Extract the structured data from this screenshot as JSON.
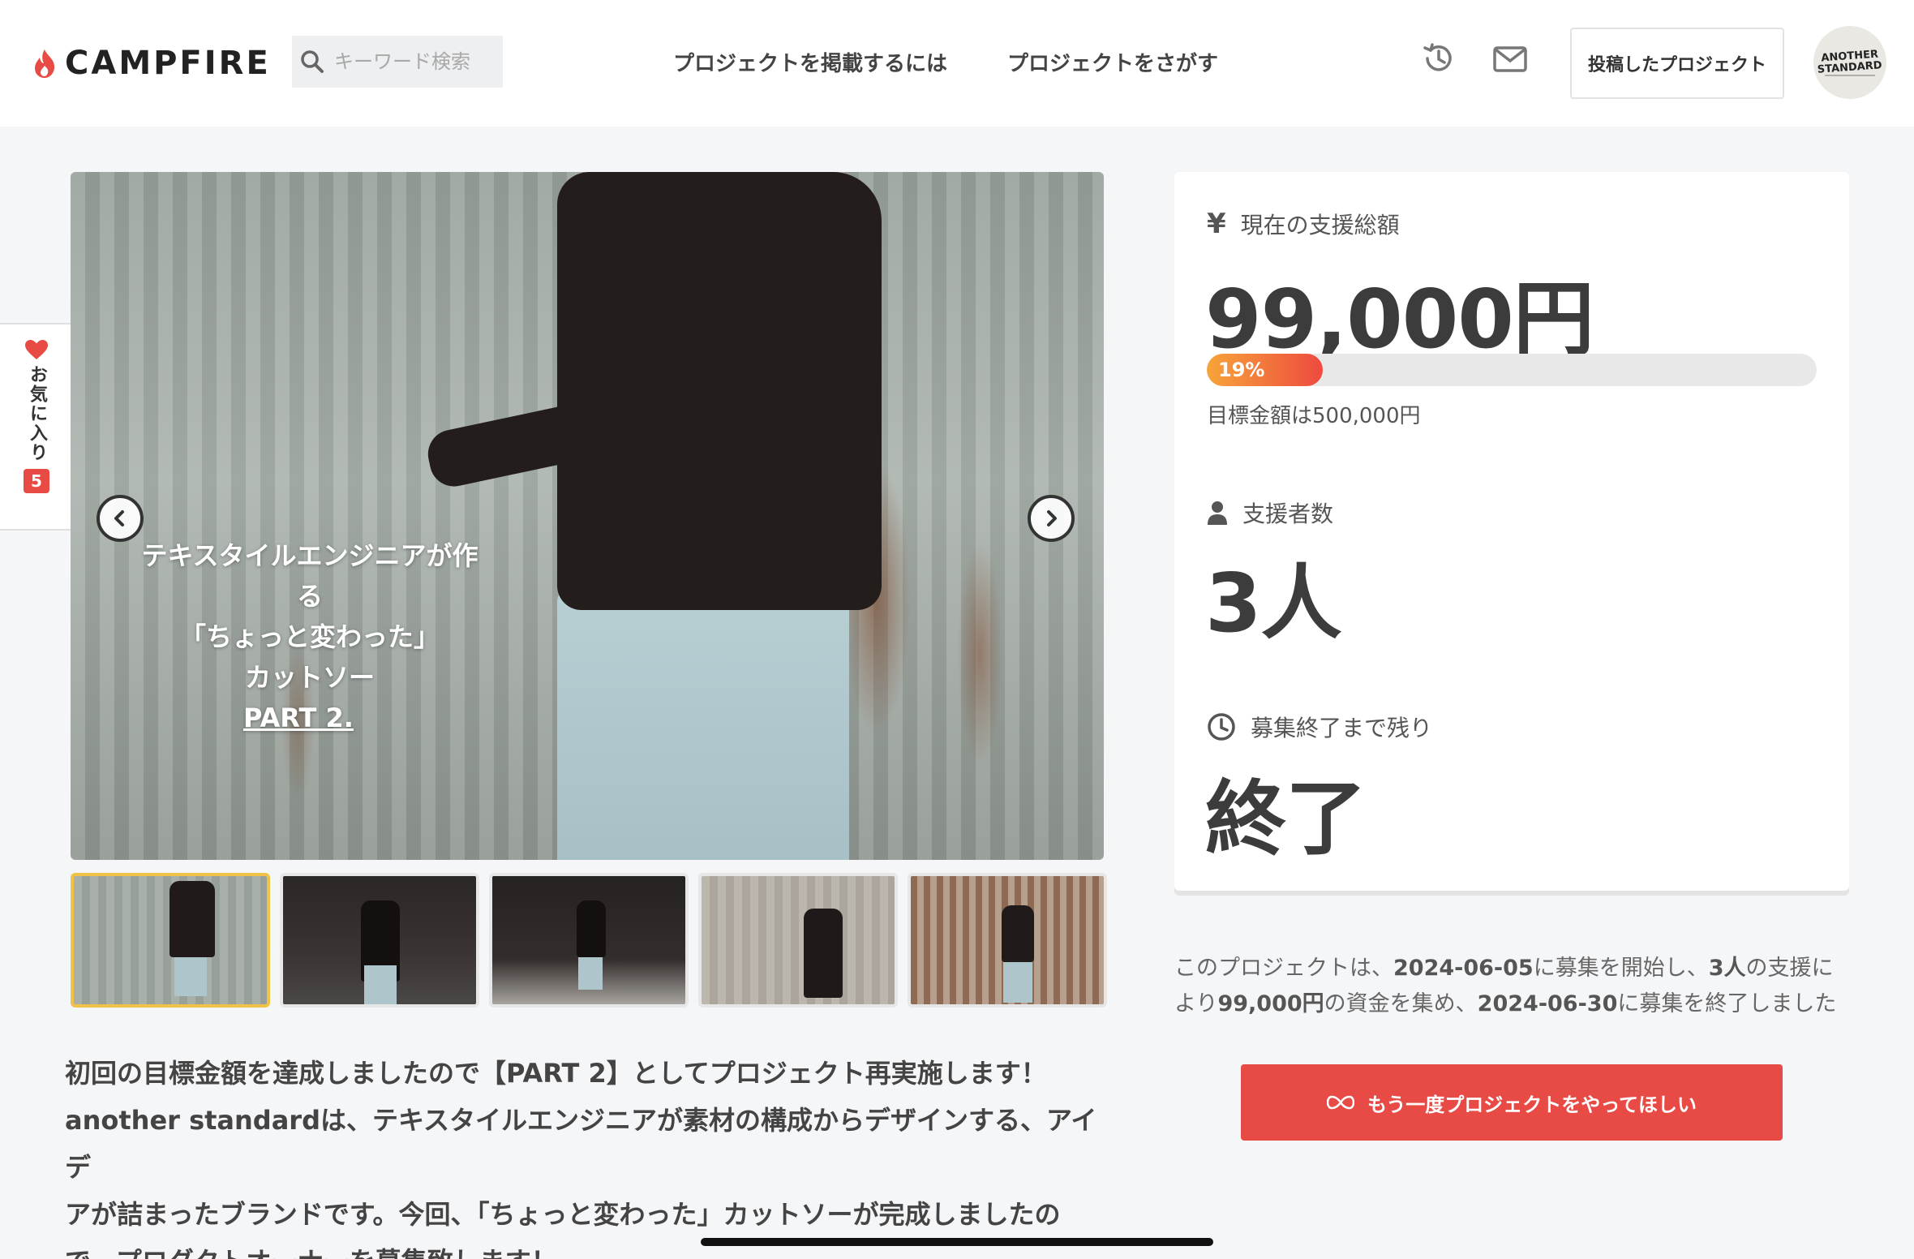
{
  "header": {
    "logo_text": "CAMPFIRE",
    "search_placeholder": "キーワード検索",
    "nav_post": "プロジェクトを掲載するには",
    "nav_find": "プロジェクトをさがす",
    "posted_projects": "投稿したプロジェクト",
    "avatar_label": "ANOTHER STANDARD"
  },
  "favorite": {
    "label": "お気に入り",
    "count": "5"
  },
  "hero": {
    "caption_line1": "テキスタイルエンジニアが作る",
    "caption_line2": "「ちょっと変わった」",
    "caption_line3": "カットソー",
    "caption_line4": "PART 2."
  },
  "description": {
    "line1": "初回の目標金額を達成しましたので【PART 2】としてプロジェクト再実施します！",
    "line2": "another standardは、テキスタイルエンジニアが素材の構成からデザインする、アイデ",
    "line3": "アが詰まったブランドです。今回、「ちょっと変わった」カットソーが完成しましたの",
    "line4": "で、プロダクトオーナーを募集致します！"
  },
  "stats": {
    "funded_label": "現在の支援総額",
    "funded_amount": "99,000円",
    "progress_text": "19%",
    "progress_value": 0.19,
    "goal_text": "目標金額は500,000円",
    "backers_label": "支援者数",
    "backers_count": "3人",
    "remaining_label": "募集終了まで残り",
    "remaining_value": "終了"
  },
  "summary": {
    "s1": "このプロジェクトは、",
    "start_date": "2024-06-05",
    "s2": "に募集を開始し、",
    "backers": "3人",
    "s3": "の支援に",
    "s4": "より",
    "amount": "99,000円",
    "s5": "の資金を集め、",
    "end_date": "2024-06-30",
    "s6": "に募集を終了しました"
  },
  "cta": {
    "label": "もう一度プロジェクトをやってほしい"
  },
  "colors": {
    "brand_red": "#e84a45",
    "progress_orange": "#f7a43a",
    "thumb_active": "#f0c247"
  }
}
